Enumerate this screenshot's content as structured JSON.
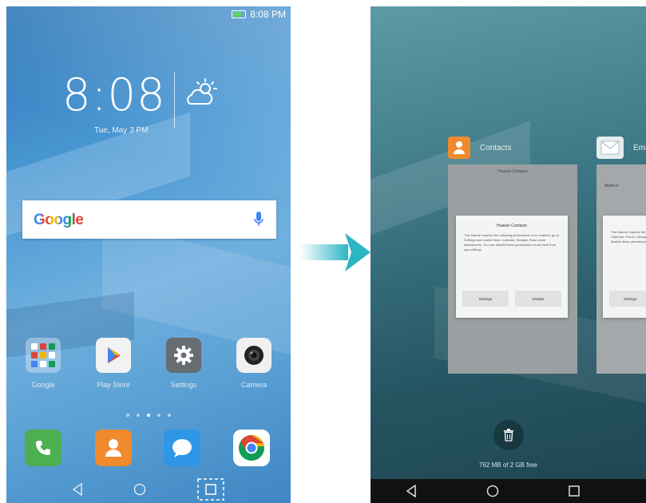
{
  "home_screen": {
    "status_time": "8:08 PM",
    "clock": {
      "time": "8:08",
      "date": "Tue, May 3 PM",
      "weather_icon": "partly-cloudy-icon"
    },
    "search": {
      "logo_text": "Google",
      "mic_icon": "microphone-icon"
    },
    "apps": [
      {
        "label": "Google",
        "icon": "google-folder-icon"
      },
      {
        "label": "Play Store",
        "icon": "play-store-icon"
      },
      {
        "label": "Settings",
        "icon": "gear-icon"
      },
      {
        "label": "Camera",
        "icon": "camera-icon"
      }
    ],
    "dock": [
      {
        "name": "phone",
        "icon": "phone-icon"
      },
      {
        "name": "contacts",
        "icon": "contact-icon"
      },
      {
        "name": "messages",
        "icon": "message-icon"
      },
      {
        "name": "chrome",
        "icon": "chrome-icon"
      }
    ],
    "nav": [
      "back-icon",
      "home-icon",
      "recent-apps-icon"
    ]
  },
  "transition_arrow": "arrow-right-icon",
  "recent_screen": {
    "cards": [
      {
        "header_title": "Contacts",
        "icon": "contact-icon",
        "body_title": "Huawei Contacts",
        "dialog_title": "Huawei Contacts",
        "dialog_text": "This feature requires the following permissions to be enabled, go to Settings and enable them: Calendar, Storage, Read email attachments. You can disable these permissions at any time from app settings.",
        "buttons": [
          "Settings",
          "Disable"
        ]
      },
      {
        "header_title": "Email",
        "icon": "mail-icon",
        "body_title": "Mailbox",
        "dialog_title": "",
        "dialog_text": "This feature requires the following permissions to be enabled: Calendar, Phone, Storage, Read email attachments. You can disable these permissions at any time from app settings.",
        "buttons": [
          "Settings"
        ]
      }
    ],
    "trash_icon": "trash-icon",
    "memory": "762 MB of 2 GB free",
    "nav": [
      "back-icon",
      "home-icon",
      "recent-apps-icon"
    ]
  },
  "colors": {
    "chrome_red": "#db4437",
    "chrome_yellow": "#f4b400",
    "chrome_green": "#0f9d58",
    "google_blue": "#4285f4"
  }
}
